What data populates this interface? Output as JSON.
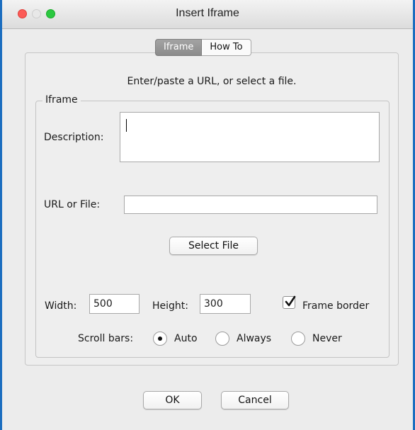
{
  "window": {
    "title": "Insert Iframe"
  },
  "tabs": [
    {
      "label": "Iframe"
    },
    {
      "label": "How To"
    }
  ],
  "instructions": "Enter/paste a URL, or select a file.",
  "group": {
    "title": "Iframe"
  },
  "form": {
    "description_label": "Description:",
    "description_value": "",
    "url_label": "URL or File:",
    "url_value": "",
    "select_file_label": "Select File",
    "width_label": "Width:",
    "width_value": "500",
    "height_label": "Height:",
    "height_value": "300",
    "frame_border_label": "Frame border",
    "frame_border_checked": true,
    "scroll_label": "Scroll bars:",
    "scroll_options": [
      {
        "label": "Auto"
      },
      {
        "label": "Always"
      },
      {
        "label": "Never"
      }
    ],
    "scroll_selected": "Auto"
  },
  "buttons": {
    "ok_label": "OK",
    "cancel_label": "Cancel"
  },
  "colors": {
    "window_border": "#1b6dbf",
    "close": "#fc5b57",
    "maximize": "#2bc840",
    "active_tab": "#969696"
  }
}
